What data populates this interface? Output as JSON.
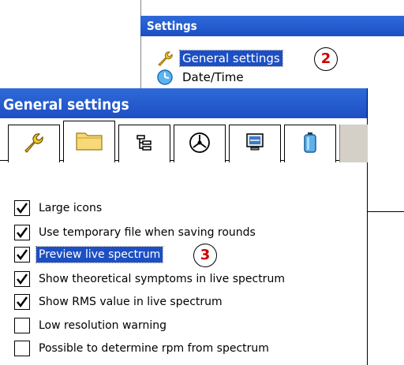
{
  "settings_window": {
    "title": "Settings",
    "items": [
      {
        "label": "General settings",
        "icon": "wrench-icon",
        "selected": true
      },
      {
        "label": "Date/Time",
        "icon": "clock-icon",
        "selected": false
      }
    ]
  },
  "callouts": {
    "step2": "2",
    "step3": "3"
  },
  "general_window": {
    "title": "General settings",
    "tabs": [
      {
        "icon": "wrench-icon"
      },
      {
        "icon": "folder-icon",
        "active": true
      },
      {
        "icon": "tree-icon"
      },
      {
        "icon": "gauge-icon"
      },
      {
        "icon": "monitor-icon"
      },
      {
        "icon": "battery-icon"
      }
    ],
    "options": [
      {
        "label": "Large icons",
        "checked": true
      },
      {
        "label": "Use temporary file when saving rounds",
        "checked": true
      },
      {
        "label": "Preview live spectrum",
        "checked": true,
        "selected": true
      },
      {
        "label": "Show theoretical symptoms in live spectrum",
        "checked": true
      },
      {
        "label": "Show RMS value in live spectrum",
        "checked": true
      },
      {
        "label": "Low resolution warning",
        "checked": false
      },
      {
        "label": "Possible to determine rpm from spectrum",
        "checked": false
      }
    ]
  },
  "colors": {
    "titlebar": "#1c4fc4",
    "selection": "#1c4fc4",
    "callout_text": "#cc0000"
  }
}
